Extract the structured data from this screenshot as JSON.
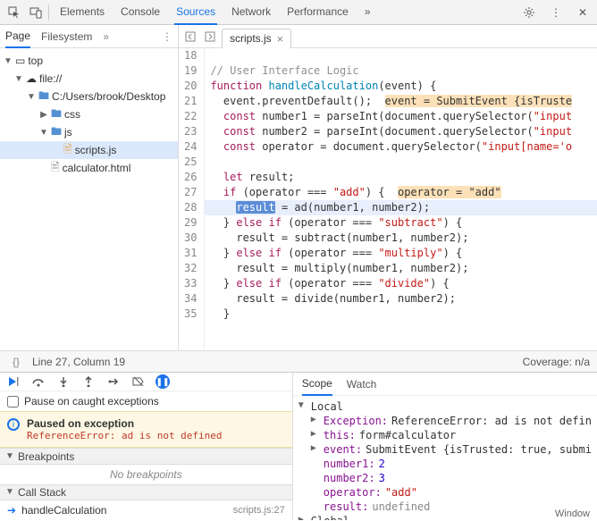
{
  "toolbar": {
    "tabs": [
      "Elements",
      "Console",
      "Sources",
      "Network",
      "Performance"
    ],
    "active_tab": 2
  },
  "left": {
    "tabs": [
      "Page",
      "Filesystem"
    ],
    "active": 0,
    "tree": {
      "top": "top",
      "file": "file://",
      "path": "C:/Users/brook/Desktop",
      "css": "css",
      "js": "js",
      "scripts": "scripts.js",
      "calc": "calculator.html"
    }
  },
  "editor_tab": "scripts.js",
  "gutter_start": 18,
  "code_lines": [
    {
      "raw": "",
      "cls": ""
    },
    {
      "raw": "// User Interface Logic",
      "cls": "c-comment"
    },
    {
      "raw": "function handleCalculation(event) {",
      "html": "<span class='c-kw'>function</span> <span class='c-fn'>handleCalculation</span>(event) {"
    },
    {
      "raw": "  event.preventDefault();  event = SubmitEvent {isTruste",
      "html": "  event.preventDefault();  <span class='c-tok'>event = SubmitEvent {isTruste</span>"
    },
    {
      "raw": "  const number1 = parseInt(document.querySelector(\"input",
      "html": "  <span class='c-kw'>const</span> number1 = parseInt(document.querySelector(<span class='c-str'>\"input</span>"
    },
    {
      "raw": "  const number2 = parseInt(document.querySelector(\"input",
      "html": "  <span class='c-kw'>const</span> number2 = parseInt(document.querySelector(<span class='c-str'>\"input</span>"
    },
    {
      "raw": "  const operator = document.querySelector(\"input[name='o",
      "html": "  <span class='c-kw'>const</span> operator = document.querySelector(<span class='c-str'>\"input[name='o</span>"
    },
    {
      "raw": "",
      "cls": ""
    },
    {
      "raw": "  let result;",
      "html": "  <span class='c-kw'>let</span> result;"
    },
    {
      "raw": "  if (operator === \"add\") {  operator = \"add\"",
      "html": "  <span class='c-kw'>if</span> (operator === <span class='c-str'>\"add\"</span>) {  <span class='c-tok'>operator = \"add\"</span>"
    },
    {
      "raw": "    result = ad(number1, number2);",
      "html": "    <span class='c-tok-sel'>result</span> = ad(number1, number2);",
      "highlight": true
    },
    {
      "raw": "  } else if (operator === \"subtract\") {",
      "html": "  } <span class='c-kw'>else if</span> (operator === <span class='c-str'>\"subtract\"</span>) {"
    },
    {
      "raw": "    result = subtract(number1, number2);",
      "html": "    result = subtract(number1, number2);"
    },
    {
      "raw": "  } else if (operator === \"multiply\") {",
      "html": "  } <span class='c-kw'>else if</span> (operator === <span class='c-str'>\"multiply\"</span>) {"
    },
    {
      "raw": "    result = multiply(number1, number2);",
      "html": "    result = multiply(number1, number2);"
    },
    {
      "raw": "  } else if (operator === \"divide\") {",
      "html": "  } <span class='c-kw'>else if</span> (operator === <span class='c-str'>\"divide\"</span>) {"
    },
    {
      "raw": "    result = divide(number1, number2);",
      "html": "    result = divide(number1, number2);"
    },
    {
      "raw": "  }",
      "cls": ""
    }
  ],
  "status": {
    "pos": "Line 27, Column 19",
    "coverage": "Coverage: n/a"
  },
  "debug": {
    "pause_checkbox": "Pause on caught exceptions",
    "banner_title": "Paused on exception",
    "banner_err": "ReferenceError: ad is not defined",
    "breakpoints_hdr": "Breakpoints",
    "no_breakpoints": "No breakpoints",
    "callstack_hdr": "Call Stack",
    "frame": "handleCalculation",
    "frame_loc": "scripts.js:27"
  },
  "scope": {
    "tabs": [
      "Scope",
      "Watch"
    ],
    "active": 0,
    "local": "Local",
    "exception_label": "Exception:",
    "exception_val": "ReferenceError: ad is not defin",
    "this_label": "this:",
    "this_val": "form#calculator",
    "event_label": "event:",
    "event_val": "SubmitEvent {isTrusted: true, submi",
    "number1_label": "number1:",
    "number1_val": "2",
    "number2_label": "number2:",
    "number2_val": "3",
    "operator_label": "operator:",
    "operator_val": "\"add\"",
    "result_label": "result:",
    "result_val": "undefined",
    "global": "Global",
    "window": "Window"
  }
}
